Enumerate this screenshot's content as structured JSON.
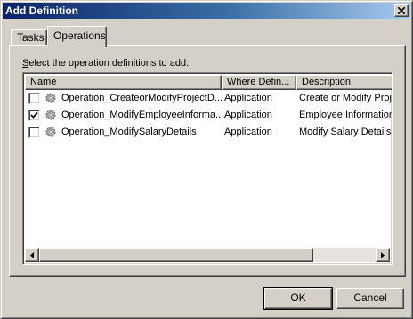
{
  "window": {
    "title": "Add Definition"
  },
  "tabs": [
    {
      "label": "Tasks",
      "selected": false
    },
    {
      "label": "Operations",
      "selected": true
    }
  ],
  "instruction": {
    "prefix": "",
    "accel": "S",
    "rest": "elect the operation definitions to add:"
  },
  "list": {
    "columns": [
      "Name",
      "Where Defin...",
      "Description"
    ],
    "rows": [
      {
        "checked": false,
        "name": "Operation_CreateorModifyProjectD...",
        "where": "Application",
        "description": "Create or Modify Proje"
      },
      {
        "checked": true,
        "name": "Operation_ModifyEmployeeInforma...",
        "where": "Application",
        "description": "Employee Information"
      },
      {
        "checked": false,
        "name": "Operation_ModifySalaryDetails",
        "where": "Application",
        "description": "Modify Salary Details"
      }
    ]
  },
  "buttons": {
    "ok": "OK",
    "cancel": "Cancel"
  },
  "colors": {
    "title_start": "#0a246a",
    "title_end": "#a6caf0",
    "face": "#d4d0c8"
  }
}
